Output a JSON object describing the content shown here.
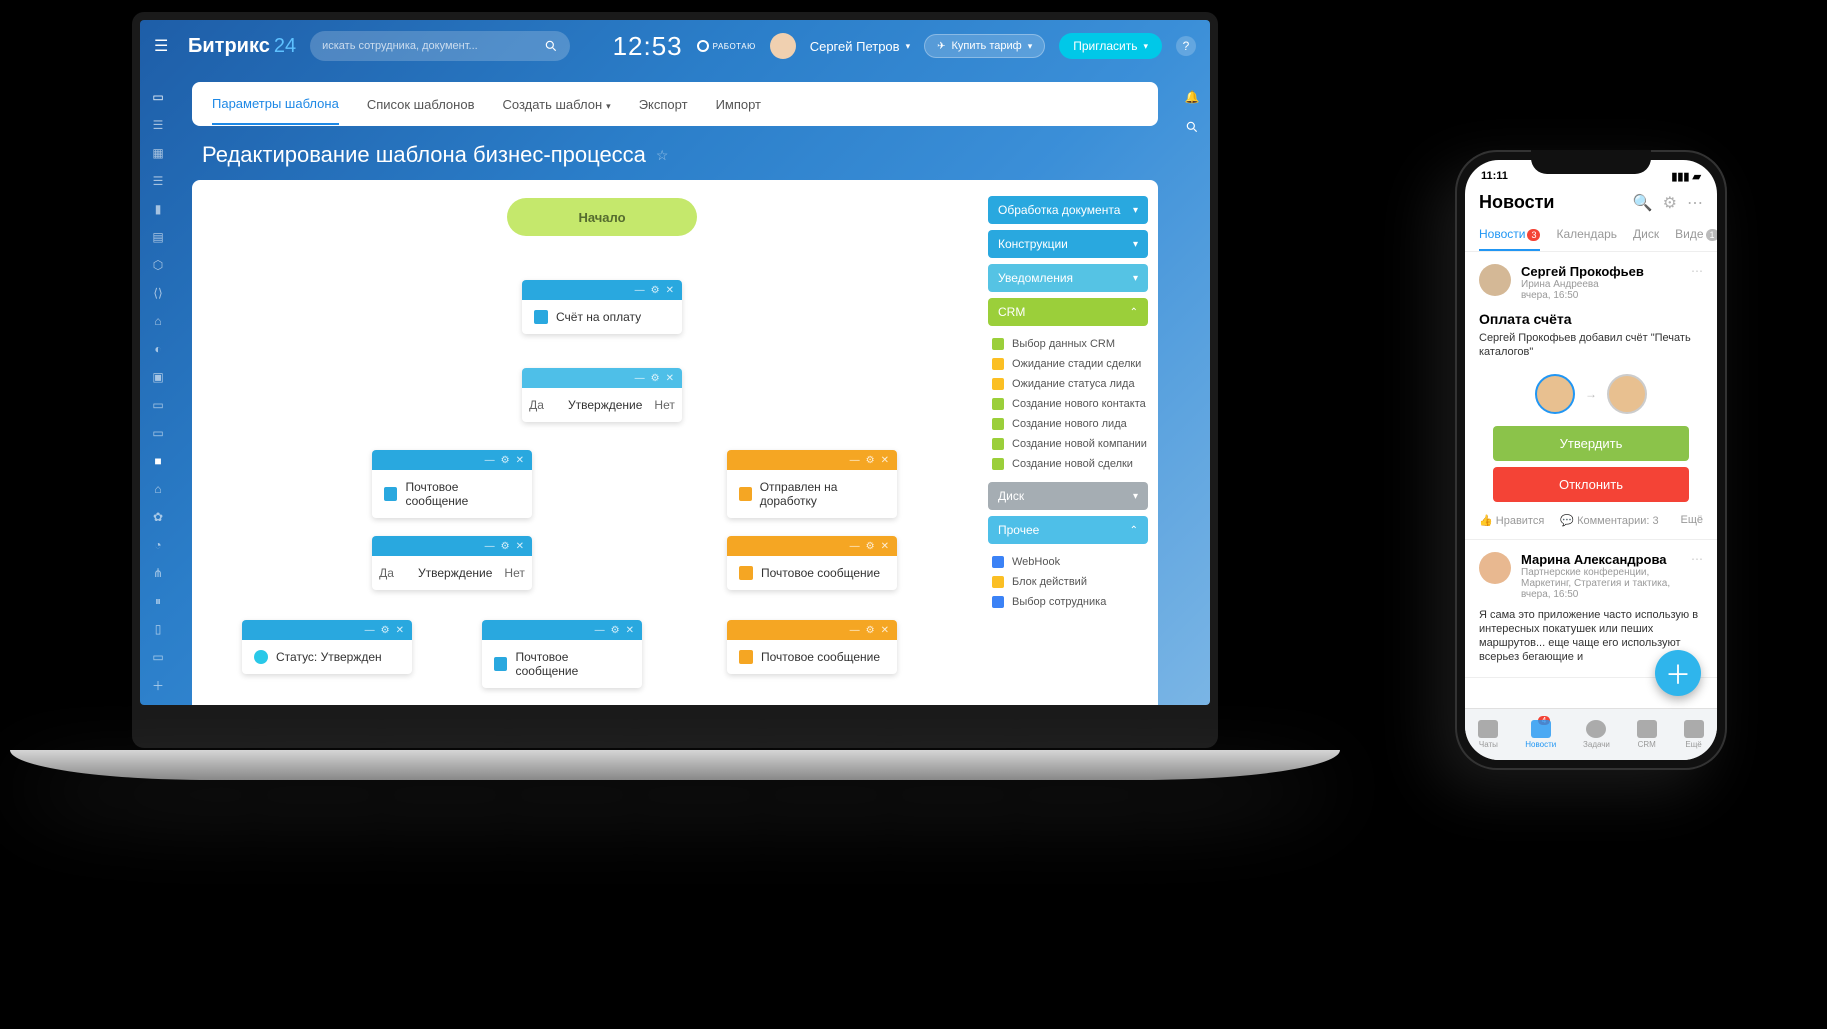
{
  "brand": {
    "name": "Битрикс",
    "suffix": "24"
  },
  "search_placeholder": "искать сотрудника, документ...",
  "clock": "12:53",
  "work_status": "РАБОТАЮ",
  "user": "Сергей Петров",
  "buy_plan": "Купить тариф",
  "invite": "Пригласить",
  "tabs": {
    "params": "Параметры шаблона",
    "list": "Список шаблонов",
    "create": "Создать шаблон",
    "export": "Экспорт",
    "import": "Импорт"
  },
  "page_title": "Редактирование шаблона бизнес-процесса",
  "flow": {
    "start": "Начало",
    "invoice": "Счёт на оплату",
    "approve": "Утверждение",
    "yes": "Да",
    "no": "Нет",
    "mail": "Почтовое сообщение",
    "rework": "Отправлен на доработку",
    "status_approved": "Статус: Утвержден"
  },
  "panel": {
    "doc": "Обработка документа",
    "constr": "Конструкции",
    "notif": "Уведомления",
    "crm": "CRM",
    "crm_items": {
      "select": "Выбор данных CRM",
      "wait_deal": "Ожидание стадии сделки",
      "wait_lead": "Ожидание статуса лида",
      "new_contact": "Создание нового контакта",
      "new_lead": "Создание нового лида",
      "new_company": "Создание новой компании",
      "new_deal": "Создание новой сделки"
    },
    "disk": "Диск",
    "other": "Прочее",
    "other_items": {
      "webhook": "WebHook",
      "block": "Блок действий",
      "employee": "Выбор сотрудника"
    }
  },
  "phone": {
    "time": "11:11",
    "header": "Новости",
    "tabs": {
      "news": "Новости",
      "calendar": "Календарь",
      "disk": "Диск",
      "video": "Виде"
    },
    "post1": {
      "name": "Сергей Прокофьев",
      "from": "Ирина Андреева",
      "time": "вчера, 16:50",
      "title": "Оплата счёта",
      "text": "Сергей Прокофьев добавил счёт \"Печать каталогов\""
    },
    "approve": "Утвердить",
    "reject": "Отклонить",
    "like": "Нравится",
    "comments": "Комментарии: 3",
    "more": "Ещё",
    "post2": {
      "name": "Марина Александрова",
      "meta": "Партнерские конференции, Маркетинг, Стратегия и тактика,",
      "time": "вчера, 16:50",
      "text": "Я сама это приложение часто использую в интересных покатушек или пеших маршрутов... еще чаще его используют всерьез бегающие и"
    },
    "tabbar": {
      "chats": "Чаты",
      "news": "Новости",
      "tasks": "Задачи",
      "crm": "CRM",
      "more": "Ещё"
    },
    "news_badge": "4",
    "news_tab_badge": "3",
    "video_badge": "1"
  }
}
